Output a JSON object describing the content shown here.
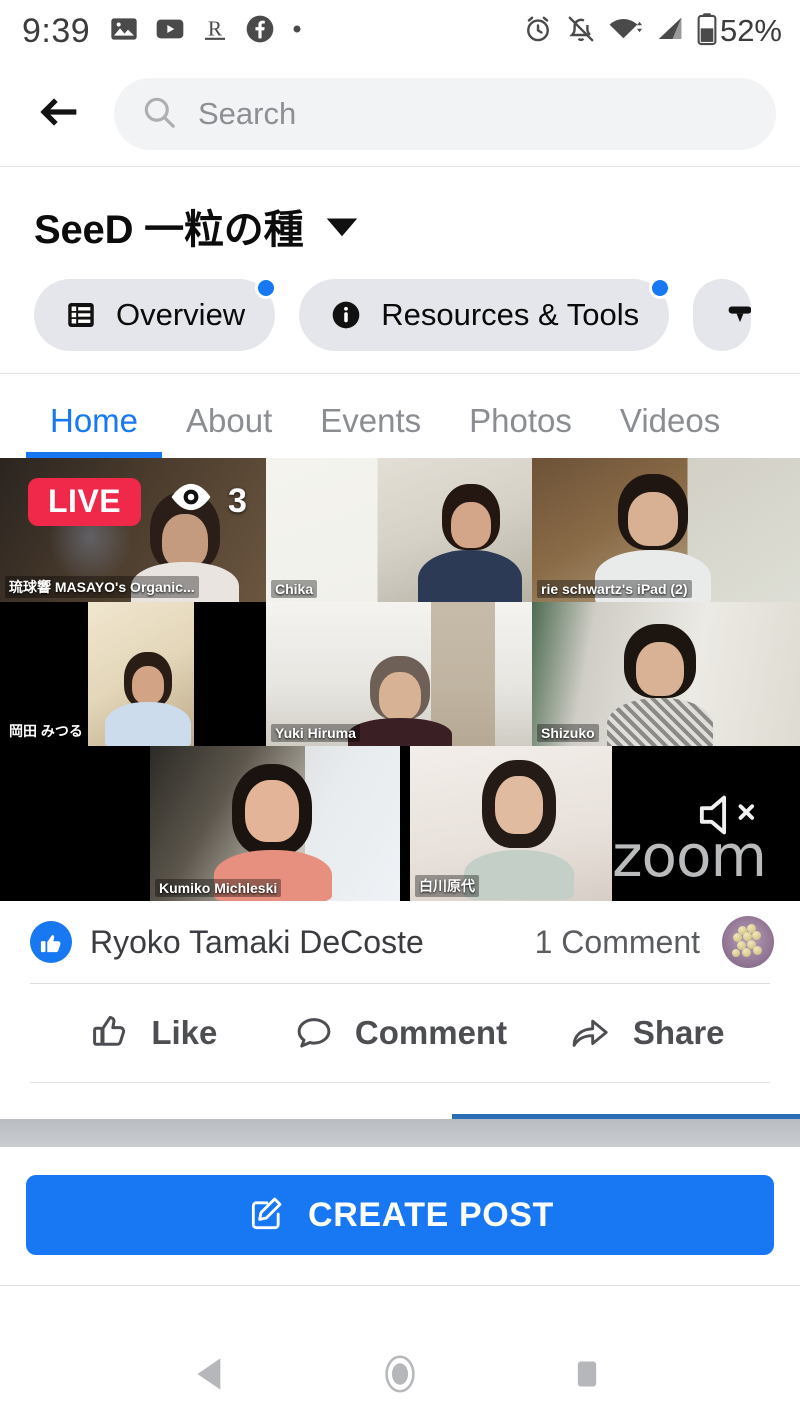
{
  "status_bar": {
    "time": "9:39",
    "battery_percent": "52%",
    "left_icons": [
      "photos-icon",
      "youtube-icon",
      "reddit-icon",
      "facebook-icon",
      "more-dot-icon"
    ],
    "right_icons": [
      "alarm-icon",
      "notifications-off-icon",
      "wifi-icon",
      "cellular-signal-icon",
      "battery-icon"
    ]
  },
  "header": {
    "back_icon": "arrow-left-icon",
    "search_icon": "search-icon",
    "search_value": "",
    "search_placeholder": "Search"
  },
  "page": {
    "title": "SeeD  一粒の種",
    "caret_icon": "chevron-down-icon"
  },
  "chips": [
    {
      "label": "Overview",
      "icon": "list-overview-icon",
      "has_badge": true
    },
    {
      "label": "Resources & Tools",
      "icon": "info-circle-icon",
      "has_badge": true
    },
    {
      "label": "",
      "icon": "pin-icon",
      "has_badge": false
    }
  ],
  "tabs": [
    {
      "label": "Home",
      "active": true
    },
    {
      "label": "About",
      "active": false
    },
    {
      "label": "Events",
      "active": false
    },
    {
      "label": "Photos",
      "active": false
    },
    {
      "label": "Videos",
      "active": false
    }
  ],
  "post": {
    "live_badge": "LIVE",
    "viewer_icon": "eye-icon",
    "viewer_count": "3",
    "zoom_watermark": "zoom",
    "mute_icon": "speaker-muted-icon",
    "video_grid": {
      "rows": [
        [
          {
            "name": "琉球響 MASAYO's Organic...",
            "speaking": false
          },
          {
            "name": "Chika",
            "speaking": false
          },
          {
            "name": "rie schwartz's iPad (2)",
            "speaking": false
          }
        ],
        [
          {
            "name": "岡田 みつる",
            "speaking": false
          },
          {
            "name": "Yuki Hiruma",
            "speaking": false
          },
          {
            "name": "Shizuko",
            "speaking": false
          }
        ],
        [
          {
            "name": "Kumiko Michleski",
            "speaking": true
          },
          {
            "name": "白川原代",
            "speaking": false
          }
        ]
      ]
    },
    "meta": {
      "like_icon": "thumbs-up-filled-icon",
      "liker_name": "Ryoko Tamaki DeCoste",
      "comment_count": "1 Comment",
      "commenter_avatar": "soybeans-avatar"
    },
    "actions": [
      {
        "label": "Like",
        "icon": "thumbs-up-outline-icon"
      },
      {
        "label": "Comment",
        "icon": "comment-bubble-icon"
      },
      {
        "label": "Share",
        "icon": "share-arrow-icon"
      }
    ]
  },
  "create_post": {
    "label": "CREATE POST",
    "icon": "compose-pencil-icon"
  },
  "nav_bar": [
    {
      "name": "back",
      "icon": "nav-back-triangle-icon"
    },
    {
      "name": "home",
      "icon": "nav-home-circle-icon"
    },
    {
      "name": "recents",
      "icon": "nav-recents-square-icon"
    }
  ],
  "colors": {
    "accent_blue": "#1778f2",
    "live_red": "#f02849",
    "speaking_green": "#35e21a",
    "chip_gray": "#e5e6eb"
  }
}
